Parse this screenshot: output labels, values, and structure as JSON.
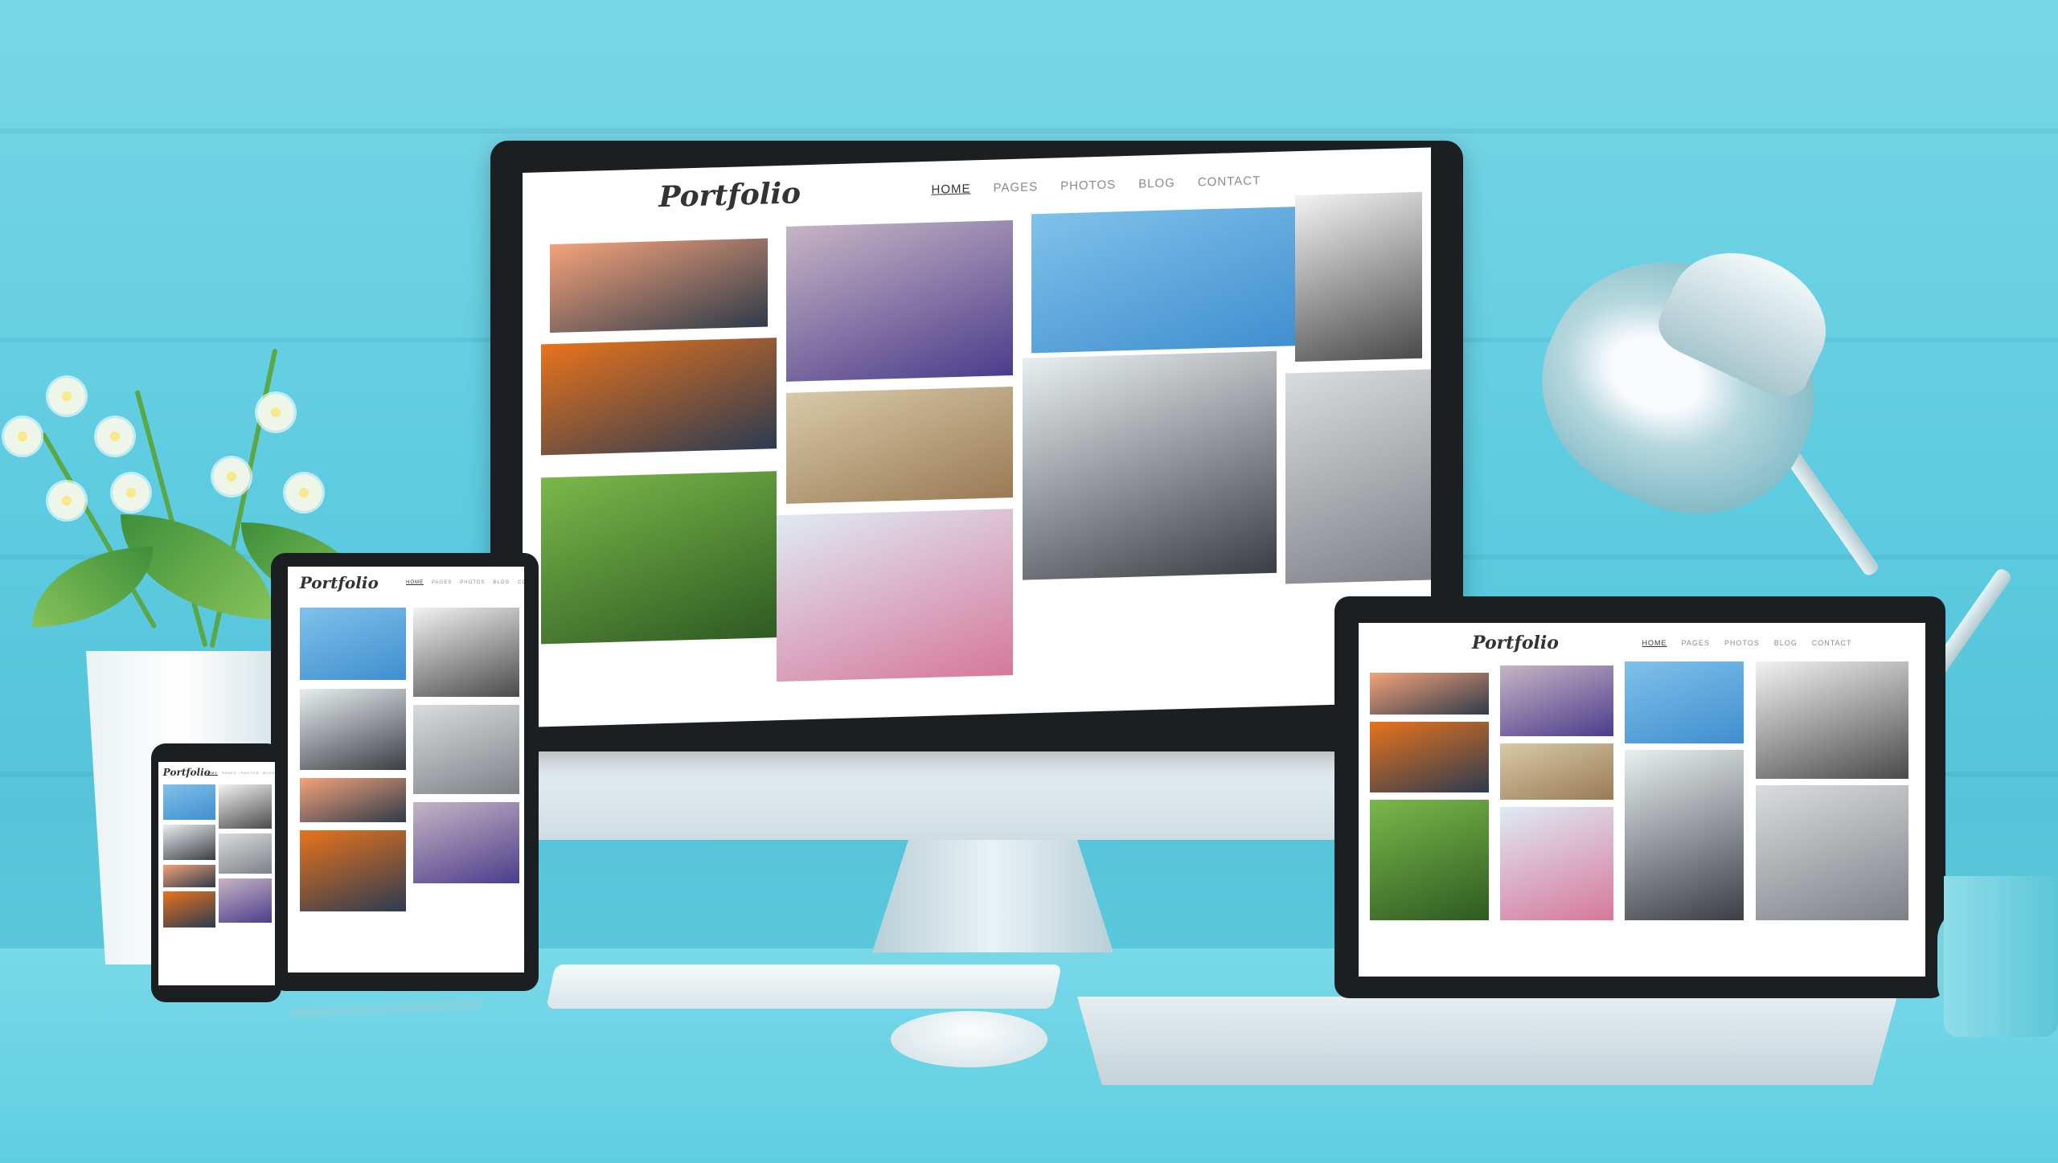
{
  "site": {
    "logo": "Portfolio",
    "nav": [
      "HOME",
      "PAGES",
      "PHOTOS",
      "BLOG",
      "CONTACT"
    ],
    "active_nav": "HOME"
  },
  "tiles": [
    {
      "name": "sunset-sailboats-photo",
      "colors": [
        "#f4a27a",
        "#2f3b4a"
      ]
    },
    {
      "name": "starfish-photo",
      "colors": [
        "#e8731c",
        "#2b3b52"
      ]
    },
    {
      "name": "green-moss-photo",
      "colors": [
        "#7ab84a",
        "#2f5a22"
      ]
    },
    {
      "name": "grape-hyacinth-photo",
      "colors": [
        "#c6b4c4",
        "#4b3d8c"
      ]
    },
    {
      "name": "coastal-town-photo",
      "colors": [
        "#d8c9a8",
        "#9a7a55"
      ]
    },
    {
      "name": "pink-blossom-photo",
      "colors": [
        "#dfeaf2",
        "#d6789a"
      ]
    },
    {
      "name": "jellyfish-photo",
      "colors": [
        "#7fc2ea",
        "#3f8ed0"
      ]
    },
    {
      "name": "foggy-village-photo",
      "colors": [
        "#e9eef1",
        "#3b3f44"
      ]
    },
    {
      "name": "steel-bridge-photo",
      "colors": [
        "#f2f2f2",
        "#4a4a4a"
      ]
    },
    {
      "name": "sea-waves-photo",
      "colors": [
        "#d9dcde",
        "#7d8186"
      ]
    }
  ],
  "palette": {
    "wall": "#5ccbe0",
    "frame": "#1c1f22",
    "accent": "#333333"
  }
}
